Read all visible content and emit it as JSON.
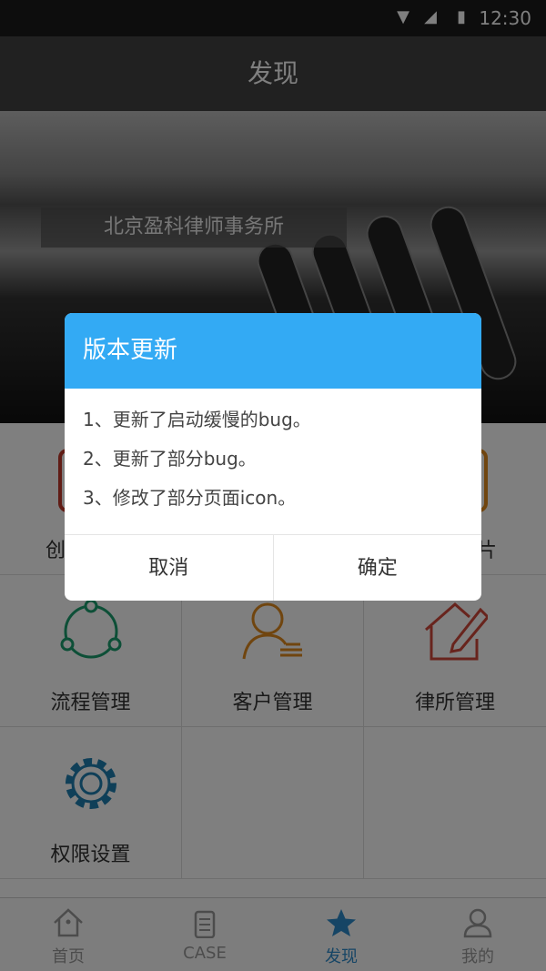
{
  "status_bar": {
    "time": "12:30",
    "icons": [
      "wifi-icon",
      "signal-icon",
      "battery-icon"
    ]
  },
  "header": {
    "title": "发现"
  },
  "banner": {
    "caption": "北京盈科律师事务所"
  },
  "grid": {
    "row1": [
      {
        "label_fragment": "创",
        "color": "#c0392b"
      },
      {
        "label_fragment": "片",
        "color": "#e08a1e"
      }
    ],
    "items": [
      {
        "label": "流程管理",
        "icon": "process-cycle-icon",
        "color": "#1a9e6e"
      },
      {
        "label": "客户管理",
        "icon": "client-person-icon",
        "color": "#e08a1e"
      },
      {
        "label": "律所管理",
        "icon": "edit-house-icon",
        "color": "#d0493b"
      },
      {
        "label": "权限设置",
        "icon": "gear-icon",
        "color": "#1f7fb0"
      }
    ]
  },
  "tabbar": {
    "tabs": [
      {
        "label": "首页",
        "icon": "home-icon"
      },
      {
        "label": "CASE",
        "icon": "clipboard-icon"
      },
      {
        "label": "发现",
        "icon": "star-icon",
        "active": true
      },
      {
        "label": "我的",
        "icon": "user-icon"
      }
    ],
    "active_color": "#2d8acb"
  },
  "dialog": {
    "title": "版本更新",
    "lines": [
      "1、更新了启动缓慢的bug。",
      "2、更新了部分bug。",
      "3、修改了部分页面icon。"
    ],
    "cancel": "取消",
    "confirm": "确定",
    "header_color": "#33aaf4"
  }
}
